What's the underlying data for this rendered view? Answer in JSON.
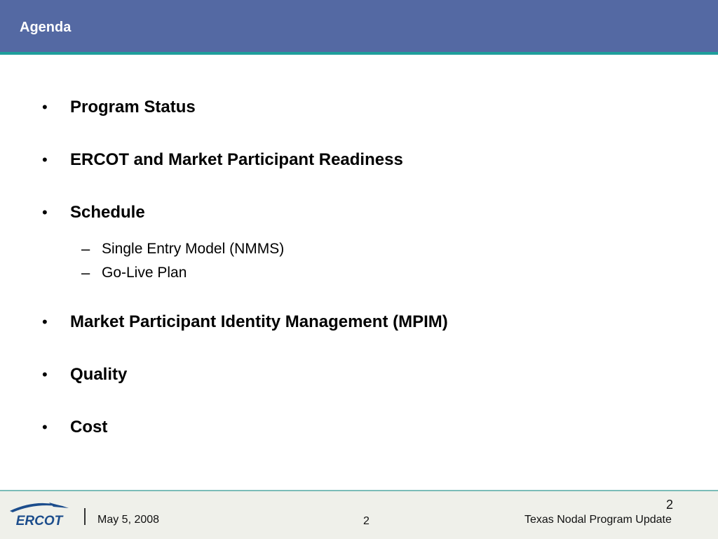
{
  "header": {
    "title": "Agenda"
  },
  "agenda": {
    "items": [
      {
        "label": "Program Status"
      },
      {
        "label": "ERCOT and Market Participant Readiness"
      },
      {
        "label": "Schedule",
        "subitems": [
          "Single Entry Model (NMMS)",
          "Go-Live Plan"
        ]
      },
      {
        "label": "Market Participant Identity Management (MPIM)"
      },
      {
        "label": "Quality"
      },
      {
        "label": "Cost"
      }
    ]
  },
  "footer": {
    "logo_text": "ERCOT",
    "date": "May 5, 2008",
    "page_number_center": "2",
    "page_number_right": "2",
    "program": "Texas Nodal Program Update"
  },
  "colors": {
    "header_bg": "#5469a3",
    "header_rule": "#1f9e9b",
    "footer_bg": "#eff0ea",
    "logo_blue": "#1c4d8c"
  },
  "icons": {
    "bullet": "•",
    "sub_bullet": "–"
  }
}
